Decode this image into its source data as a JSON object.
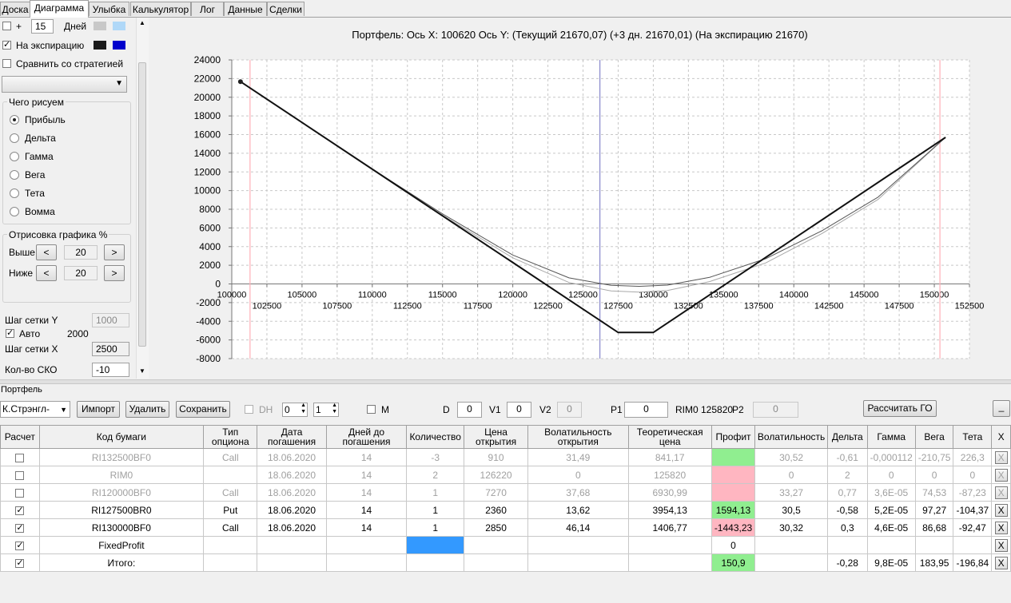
{
  "tabs": [
    "Доска",
    "Диаграмма",
    "Улыбка",
    "Калькулятор",
    "Лог",
    "Данные",
    "Сделки"
  ],
  "active_tab": "Диаграмма",
  "left": {
    "days_plus": "+",
    "days_value": "15",
    "days_label": "Дней",
    "expiry_label": "На экспирацию",
    "compare_label": "Сравнить со стратегией",
    "draw_group": "Чего рисуем",
    "draw_options": [
      "Прибыль",
      "Дельта",
      "Гамма",
      "Вега",
      "Тета",
      "Вомма"
    ],
    "selected_option": "Прибыль",
    "render_group": "Отрисовка графика %",
    "above_label": "Выше",
    "above_value": "20",
    "below_label": "Ниже",
    "below_value": "20",
    "prev": "<",
    "next": ">",
    "grid_y_label": "Шаг сетки Y",
    "grid_y_value": "1000",
    "auto_label": "Авто",
    "auto_value": "2000",
    "grid_x_label": "Шаг сетки X",
    "grid_x_value": "2500",
    "sko_label": "Кол-во СКО",
    "sko_value": "-10",
    "colors": {
      "swatch1": "#c8c8c8",
      "swatch2": "#b0d8f8",
      "swatch3": "#1a1a1a",
      "swatch4": "#0000cc"
    }
  },
  "chart_data": {
    "type": "line",
    "title": "Портфель: Ось X: 100620 Ось Y:  (Текущий 21670,07)  (+3 дн. 21670,01)  (На экспирацию 21670)",
    "xlim": [
      100000,
      152500
    ],
    "ylim": [
      -8000,
      24000
    ],
    "x_ticks_upper": [
      100000,
      105000,
      110000,
      115000,
      120000,
      125000,
      130000,
      135000,
      140000,
      145000,
      150000
    ],
    "x_ticks_lower": [
      102500,
      107500,
      112500,
      117500,
      122500,
      127500,
      132500,
      137500,
      142500,
      147500,
      152500
    ],
    "y_ticks": [
      -8000,
      -6000,
      -4000,
      -2000,
      0,
      2000,
      4000,
      6000,
      8000,
      10000,
      12000,
      14000,
      16000,
      18000,
      20000,
      22000,
      24000
    ],
    "grid": true,
    "vlines": [
      {
        "x": 101300,
        "color": "#ffb0b8"
      },
      {
        "x": 126200,
        "color": "#8888cc"
      },
      {
        "x": 150400,
        "color": "#ffb0b8"
      }
    ],
    "series": [
      {
        "color": "#111111",
        "width": 2,
        "x": [
          100620,
          127500,
          130000,
          150800
        ],
        "y": [
          21670,
          -5200,
          -5200,
          15700
        ]
      },
      {
        "color": "#555555",
        "width": 1,
        "x": [
          100620,
          110000,
          115000,
          120000,
          124000,
          127000,
          129000,
          131000,
          134000,
          138000,
          142000,
          146000,
          150800
        ],
        "y": [
          21670,
          12300,
          7500,
          3100,
          650,
          -150,
          -260,
          -130,
          700,
          2700,
          5700,
          9300,
          15700
        ]
      },
      {
        "color": "#a8a8a8",
        "width": 1,
        "x": [
          100620,
          110000,
          115000,
          120000,
          124000,
          127000,
          129000,
          131000,
          134000,
          138000,
          142000,
          146000,
          150800
        ],
        "y": [
          21670,
          12250,
          7350,
          2800,
          150,
          -750,
          -880,
          -700,
          250,
          2250,
          5400,
          9050,
          15700
        ]
      }
    ],
    "marker": {
      "x": 100620,
      "y": 21670
    }
  },
  "portfolio": {
    "label": "Портфель",
    "strategy_select": "К.Стрэнгл-Поз",
    "import": "Импорт",
    "delete": "Удалить",
    "save": "Сохранить",
    "dh_label": "DH",
    "dh_spin1": "0",
    "dh_spin2": "1",
    "m_label": "M",
    "d_label": "D",
    "d_value": "0",
    "v1_label": "V1",
    "v1_value": "0",
    "v2_label": "V2",
    "v2_value": "0",
    "p1_label": "P1",
    "p1_value": "0",
    "rim_label": "RIM0 125820",
    "p2_label": "P2",
    "p2_value": "0",
    "calc_go": "Рассчитать ГО",
    "minimize": "_"
  },
  "table": {
    "headers": [
      "Расчет",
      "Код бумаги",
      "Тип опциона",
      "Дата погашения",
      "Дней до погашения",
      "Количество",
      "Цена открытия",
      "Волатильность открытия",
      "Теоретическая цена",
      "Профит",
      "Волатильность",
      "Дельта",
      "Гамма",
      "Вега",
      "Тета",
      "X"
    ],
    "rows": [
      {
        "check": false,
        "dim": true,
        "code": "RI132500BF0",
        "type": "Call",
        "date": "18.06.2020",
        "days": "14",
        "qty": "-3",
        "open": "910",
        "vol_open": "31,49",
        "theo": "841,17",
        "profit": "",
        "profit_color": "green",
        "vol": "30,52",
        "delta": "-0,61",
        "gamma": "-0,000112",
        "vega": "-210,75",
        "theta": "226,3",
        "x": "X"
      },
      {
        "check": false,
        "dim": true,
        "code": "RIM0",
        "type": "",
        "date": "18.06.2020",
        "days": "14",
        "qty": "2",
        "open": "126220",
        "vol_open": "0",
        "theo": "125820",
        "profit": "",
        "profit_color": "pink",
        "vol": "0",
        "delta": "2",
        "gamma": "0",
        "vega": "0",
        "theta": "0",
        "x": "X"
      },
      {
        "check": false,
        "dim": true,
        "code": "RI120000BF0",
        "type": "Call",
        "date": "18.06.2020",
        "days": "14",
        "qty": "1",
        "open": "7270",
        "vol_open": "37,68",
        "theo": "6930,99",
        "profit": "",
        "profit_color": "pink",
        "vol": "33,27",
        "delta": "0,77",
        "gamma": "3,6E-05",
        "vega": "74,53",
        "theta": "-87,23",
        "x": "X"
      },
      {
        "check": true,
        "dim": false,
        "code": "RI127500BR0",
        "type": "Put",
        "date": "18.06.2020",
        "days": "14",
        "qty": "1",
        "open": "2360",
        "vol_open": "13,62",
        "theo": "3954,13",
        "profit": "1594,13",
        "profit_color": "green",
        "vol": "30,5",
        "delta": "-0,58",
        "gamma": "5,2E-05",
        "vega": "97,27",
        "theta": "-104,37",
        "x": "X"
      },
      {
        "check": true,
        "dim": false,
        "code": "RI130000BF0",
        "type": "Call",
        "date": "18.06.2020",
        "days": "14",
        "qty": "1",
        "open": "2850",
        "vol_open": "46,14",
        "theo": "1406,77",
        "profit": "-1443,23",
        "profit_color": "pink",
        "vol": "30,32",
        "delta": "0,3",
        "gamma": "4,6E-05",
        "vega": "86,68",
        "theta": "-92,47",
        "x": "X"
      },
      {
        "check": true,
        "dim": false,
        "code": "FixedProfit",
        "type": "",
        "date": "",
        "days": "",
        "qty": "",
        "open": "",
        "vol_open": "",
        "theo": "",
        "profit": "0",
        "profit_color": "",
        "vol": "",
        "delta": "",
        "gamma": "",
        "vega": "",
        "theta": "",
        "x": "X",
        "qty_color": "blue"
      },
      {
        "check": true,
        "dim": false,
        "code": "Итого:",
        "type": "",
        "date": "",
        "days": "",
        "qty": "",
        "open": "",
        "vol_open": "",
        "theo": "",
        "profit": "150,9",
        "profit_color": "green",
        "vol": "",
        "delta": "-0,28",
        "gamma": "9,8E-05",
        "vega": "183,95",
        "theta": "-196,84",
        "x": "X"
      }
    ]
  }
}
